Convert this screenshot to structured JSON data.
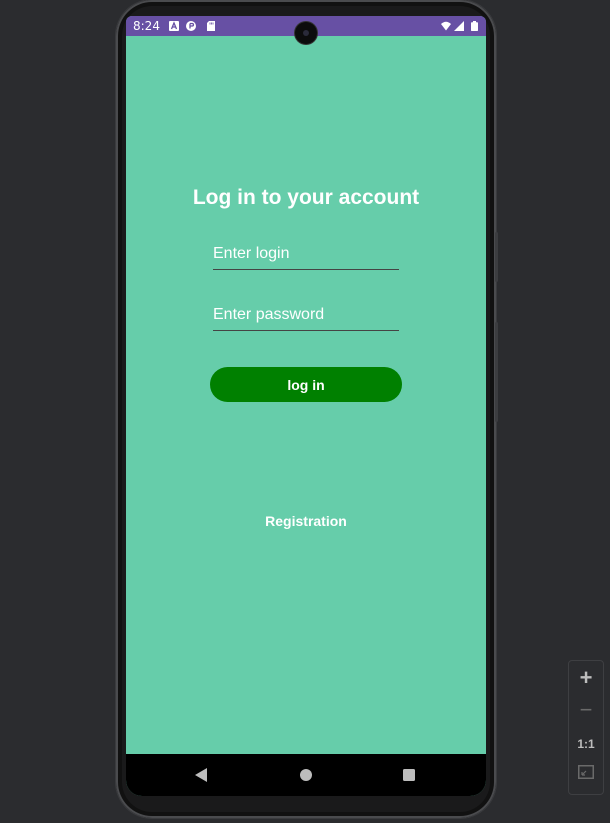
{
  "status_bar": {
    "time": "8:24",
    "background_color": "#6750a4",
    "left_icons": [
      "notification-a-icon",
      "notification-circle-icon",
      "sd-card-icon"
    ],
    "right_icons": [
      "wifi-icon",
      "signal-icon",
      "battery-icon"
    ]
  },
  "login_screen": {
    "background_color": "#66cdaa",
    "title": "Log in to your account",
    "login_placeholder": "Enter login",
    "password_placeholder": "Enter password",
    "login_button_label": "log in",
    "login_button_color": "#008000",
    "registration_label": "Registration"
  },
  "nav_bar": {
    "buttons": [
      "back-icon",
      "home-icon",
      "recents-icon"
    ]
  },
  "zoom_controls": {
    "zoom_in": "+",
    "zoom_out": "−",
    "actual_size": "1:1",
    "fit_screen_icon": "fit-screen-icon"
  }
}
